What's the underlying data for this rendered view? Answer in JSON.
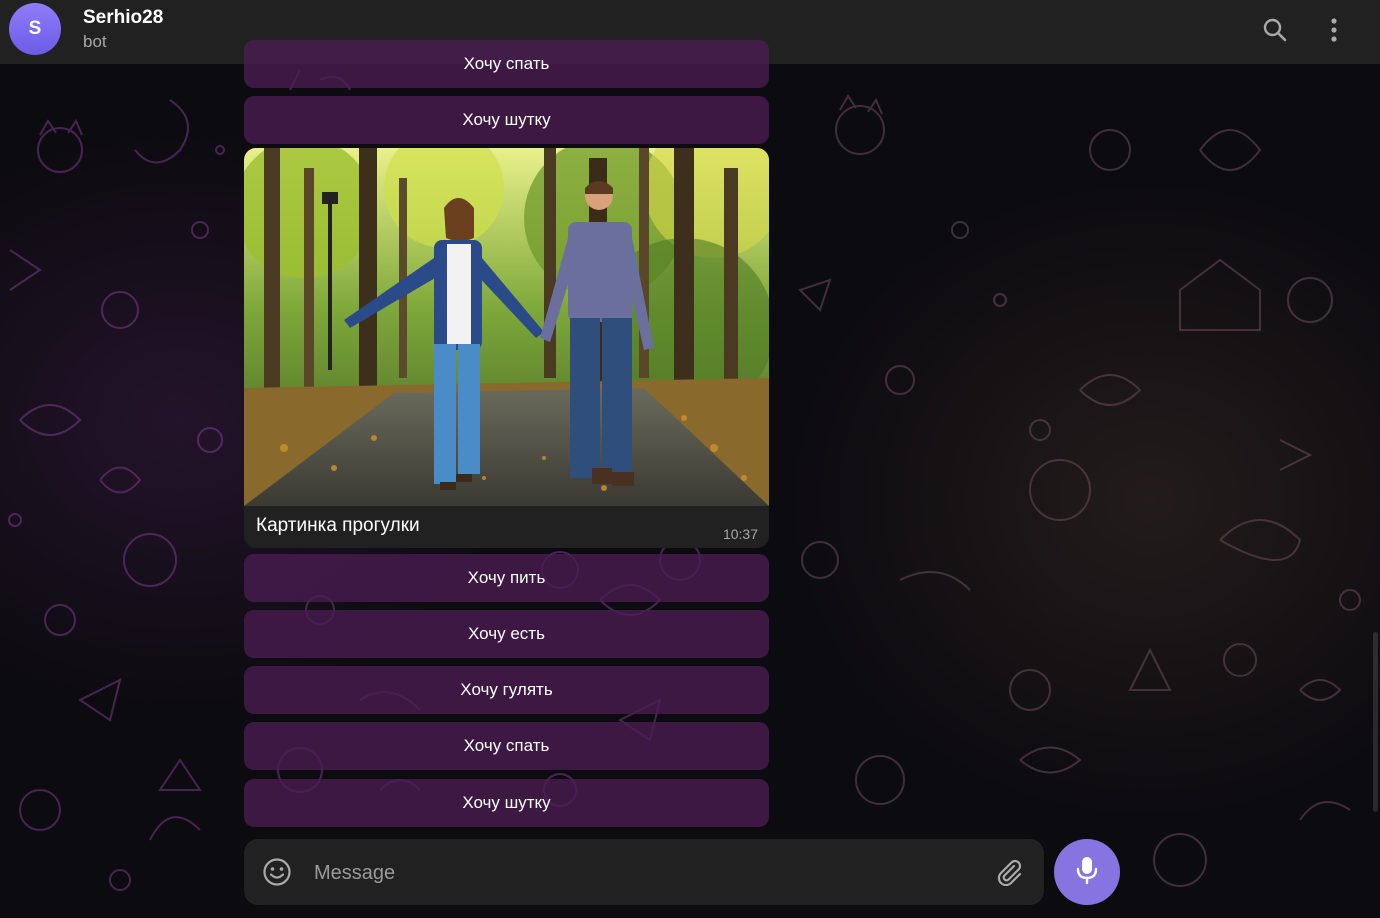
{
  "header": {
    "avatar_letter": "S",
    "title": "Serhio28",
    "subtitle": "bot"
  },
  "keyboard_top": [
    {
      "label": "Хочу спать"
    },
    {
      "label": "Хочу шутку"
    }
  ],
  "photo_message": {
    "caption": "Картинка прогулки",
    "time": "10:37"
  },
  "keyboard_bottom": [
    {
      "label": "Хочу пить"
    },
    {
      "label": "Хочу есть"
    },
    {
      "label": "Хочу гулять"
    },
    {
      "label": "Хочу спать"
    },
    {
      "label": "Хочу шутку"
    }
  ],
  "composer": {
    "placeholder": "Message"
  },
  "icons": {
    "search": "search-icon",
    "menu": "more-vertical-icon",
    "emoji": "smile-icon",
    "attach": "paperclip-icon",
    "mic": "microphone-icon"
  },
  "colors": {
    "header_bg": "#212121",
    "accent": "#8774e1",
    "keyboard_bg": "#4a1c52"
  }
}
